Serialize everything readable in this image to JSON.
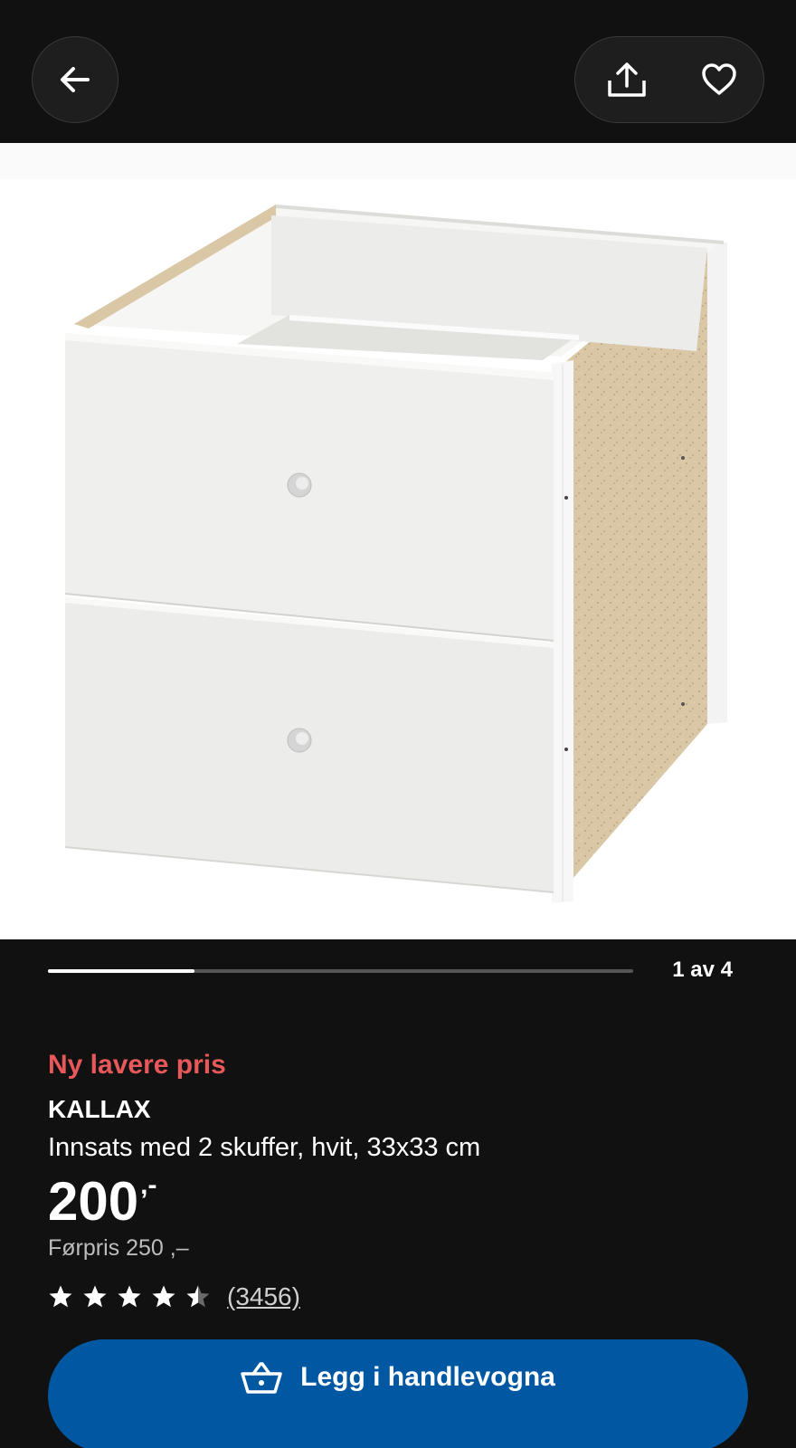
{
  "header": {
    "back_icon": "arrow-left-icon",
    "share_icon": "share-icon",
    "favourite_icon": "heart-icon"
  },
  "gallery": {
    "counter": "1 av 4",
    "current": 1,
    "total": 4,
    "product_image": "white two-drawer cube insert"
  },
  "product": {
    "promo_label": "Ny lavere pris",
    "name": "KALLAX",
    "description": "Innsats med 2 skuffer, hvit, 33x33 cm",
    "price_integer": "200",
    "price_suffix": ",-",
    "previous_price": "Førpris 250 ,–",
    "rating": 4.5,
    "rating_max": 5,
    "review_count": "(3456)"
  },
  "cart": {
    "label": "Legg i handlevogna",
    "icon": "shopping-basket-icon"
  },
  "colors": {
    "background": "#111111",
    "promo": "#e8585a",
    "cart_button": "#0058a3"
  }
}
